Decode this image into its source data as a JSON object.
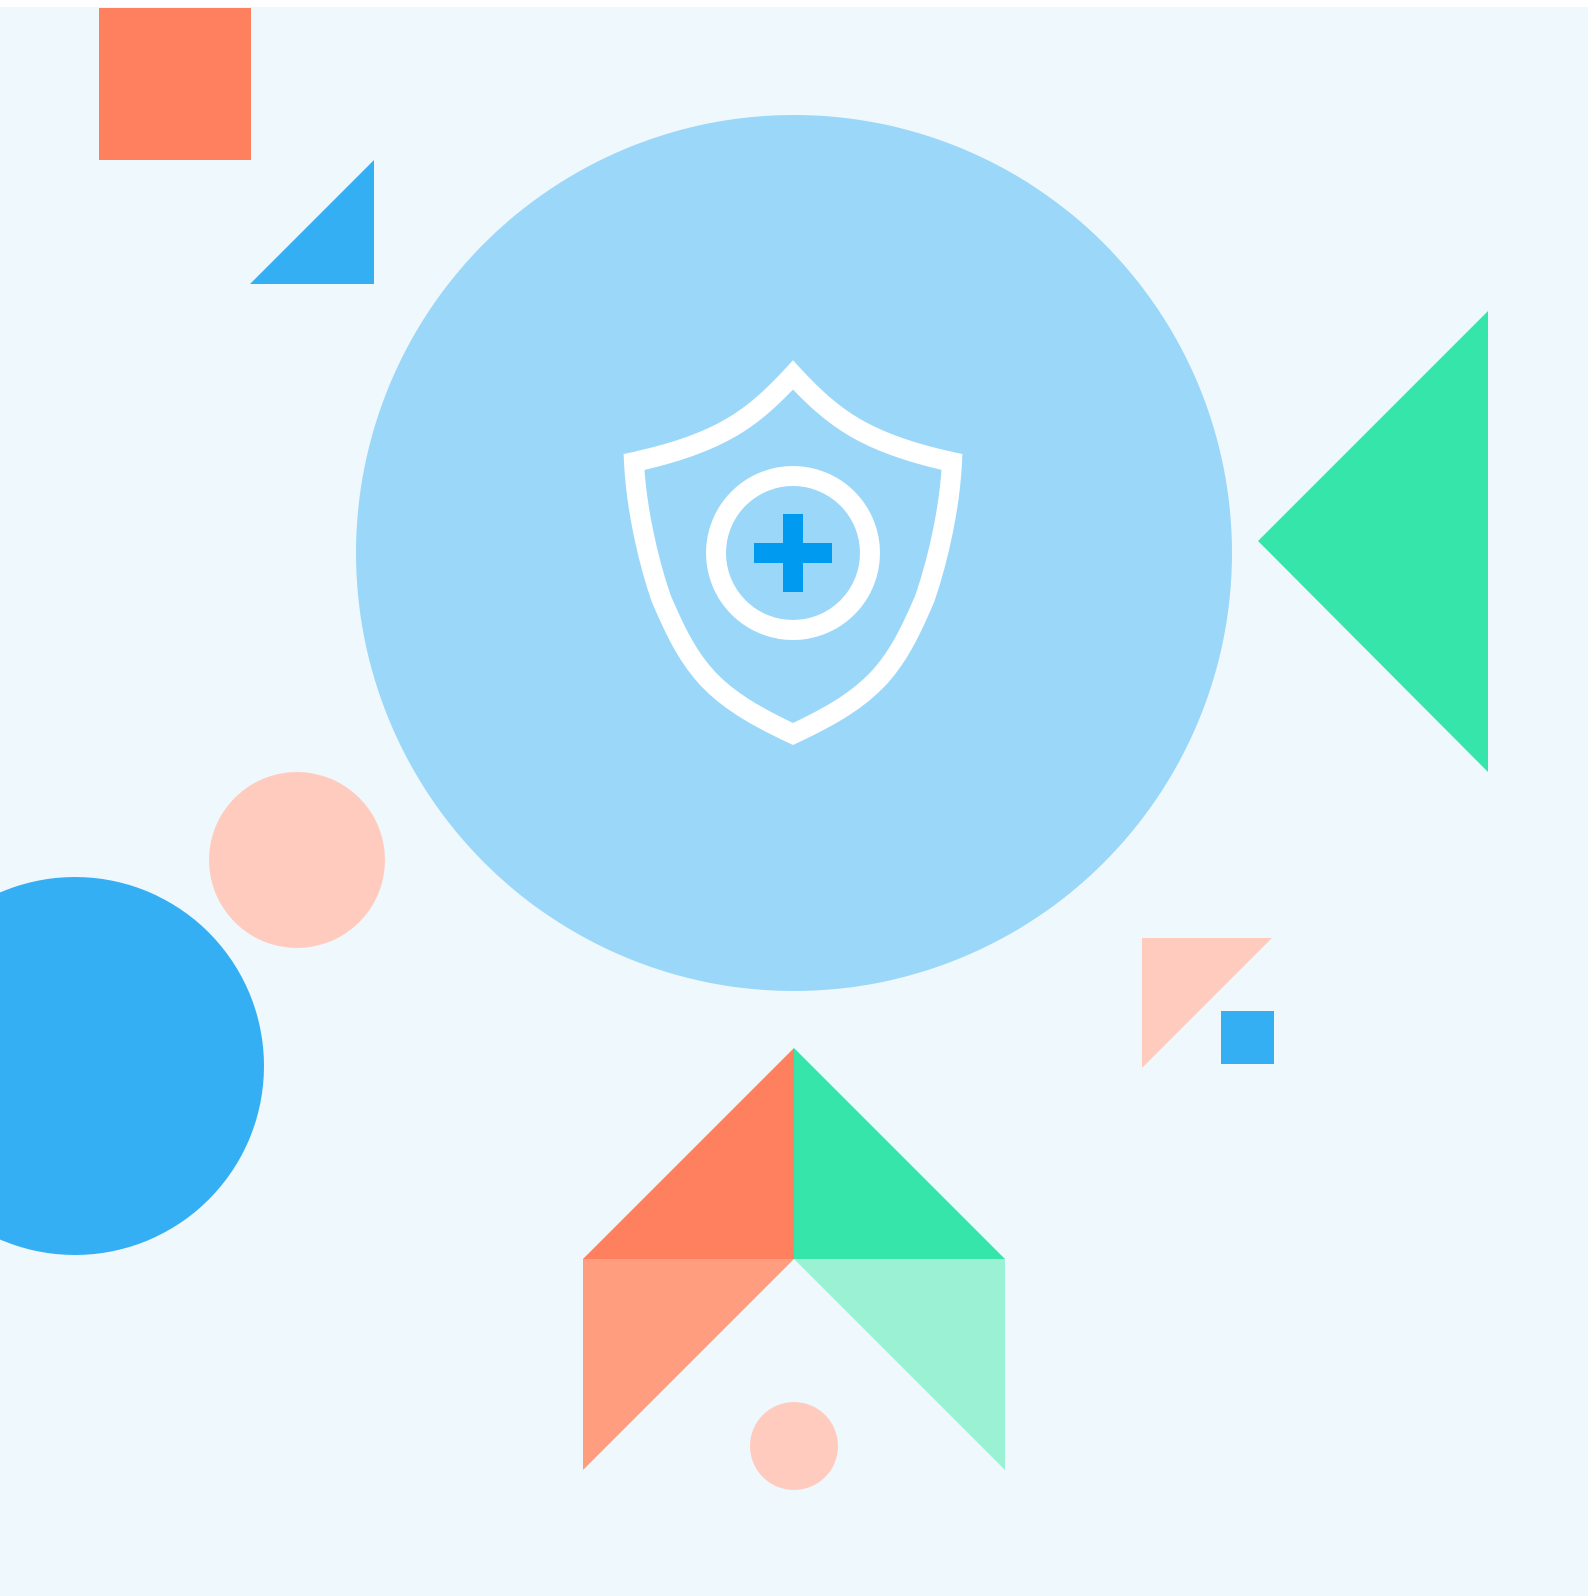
{
  "colors": {
    "page_background": "#ffffff",
    "canvas_background": "#eff8fd",
    "main_circle": "#9bd7f9",
    "shield_stroke": "#ffffff",
    "plus_icon": "#009af0",
    "coral": "#ff805e",
    "light_coral": "#ff9d7e",
    "peach": "#ffcbbe",
    "blue": "#35aff4",
    "green": "#36e5a9",
    "light_green": "#9af1d4"
  },
  "icons": {
    "main": "shield-plus-icon"
  }
}
